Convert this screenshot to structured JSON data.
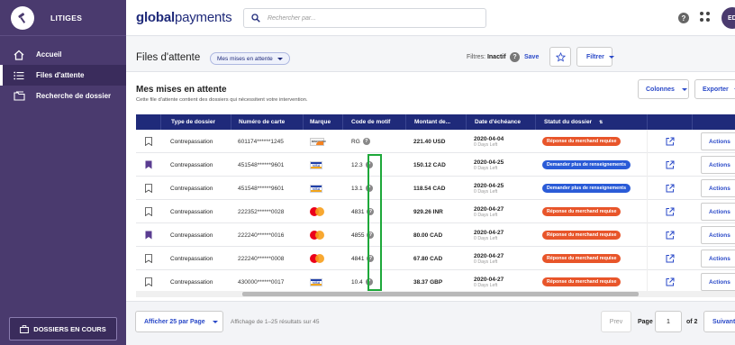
{
  "sidebar": {
    "app_title": "LITIGES",
    "items": [
      {
        "label": "Accueil",
        "icon": "home-icon"
      },
      {
        "label": "Files d'attente",
        "icon": "list-icon",
        "active": true
      },
      {
        "label": "Recherche de dossier",
        "icon": "folder-search-icon"
      }
    ],
    "bottom_button": "DOSSIERS EN COURS"
  },
  "topbar": {
    "brand_bold": "global",
    "brand_rest": "payments",
    "search_placeholder": "Rechercher par...",
    "avatar_initials": "ED"
  },
  "header": {
    "title": "Files d'attente",
    "view_pill": "Mes mises en attente",
    "filters_label": "Filtres:",
    "filters_value": "Inactif",
    "save_label": "Save",
    "filter_button": "Filtrer"
  },
  "card": {
    "title": "Mes mises en attente",
    "subtitle": "Cette file d'attente contient des dossiers qui nécessitent votre intervention.",
    "columns_button": "Colonnes",
    "export_button": "Exporter"
  },
  "table": {
    "headers": [
      "Type de dossier",
      "Numéro de carte",
      "Marque",
      "Code de motif",
      "Montant de...",
      "Date d'échéance",
      "Statut du dossier"
    ],
    "sort_glyph": "⇅",
    "actions_label": "Actions",
    "rows": [
      {
        "bookmarked": false,
        "type": "Contrepassation",
        "card": "601174******1245",
        "brand": "discover",
        "code": "RG",
        "amount": "221.40 USD",
        "date": "2020-04-04",
        "days": "0 Days Left",
        "status": "Réponse du merchand requise",
        "status_color": "#e8552a"
      },
      {
        "bookmarked": true,
        "type": "Contrepassation",
        "card": "451548******9601",
        "brand": "visa",
        "code": "12.3",
        "amount": "150.12 CAD",
        "date": "2020-04-25",
        "days": "0 Days Left",
        "status": "Demander plus de renseignements",
        "status_color": "#2a5bd7"
      },
      {
        "bookmarked": false,
        "type": "Contrepassation",
        "card": "451548******9601",
        "brand": "visa",
        "code": "13.1",
        "amount": "118.54 CAD",
        "date": "2020-04-25",
        "days": "0 Days Left",
        "status": "Demander plus de renseignements",
        "status_color": "#2a5bd7"
      },
      {
        "bookmarked": false,
        "type": "Contrepassation",
        "card": "222352******0028",
        "brand": "mastercard",
        "code": "4831",
        "amount": "929.26 INR",
        "date": "2020-04-27",
        "days": "0 Days Left",
        "status": "Réponse du merchand requise",
        "status_color": "#e8552a"
      },
      {
        "bookmarked": true,
        "type": "Contrepassation",
        "card": "222240******0016",
        "brand": "mastercard",
        "code": "4855",
        "amount": "80.00 CAD",
        "date": "2020-04-27",
        "days": "0 Days Left",
        "status": "Réponse du merchand requise",
        "status_color": "#e8552a"
      },
      {
        "bookmarked": false,
        "type": "Contrepassation",
        "card": "222240******0008",
        "brand": "mastercard",
        "code": "4841",
        "amount": "67.80 CAD",
        "date": "2020-04-27",
        "days": "0 Days Left",
        "status": "Réponse du merchand requise",
        "status_color": "#e8552a"
      },
      {
        "bookmarked": false,
        "type": "Contrepassation",
        "card": "430000******0017",
        "brand": "visa",
        "code": "10.4",
        "amount": "38.37 GBP",
        "date": "2020-04-27",
        "days": "0 Days Left",
        "status": "Réponse du merchand requise",
        "status_color": "#e8552a"
      }
    ]
  },
  "footer": {
    "per_page": "Afficher 25 par Page",
    "showing": "Affichage de 1–25 résultats sur 45",
    "prev": "Prev",
    "page_label": "Page",
    "page_value": "1",
    "of_label": "of 2",
    "next": "Suivant"
  },
  "colors": {
    "sidebar": "#4a3a6e",
    "table_header": "#1f2a7a",
    "accent_link": "#2a49c8",
    "highlight": "#1ea83a",
    "bookmark": "#5a3c91"
  }
}
